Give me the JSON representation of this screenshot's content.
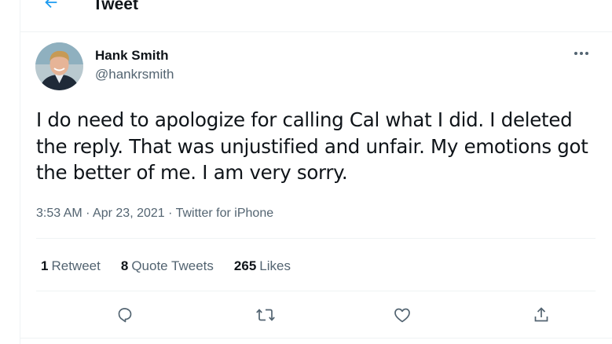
{
  "header": {
    "title": "Tweet",
    "back_icon": "arrow-left-icon",
    "accent_color": "#1d9bf0"
  },
  "tweet": {
    "author": {
      "name": "Hank Smith",
      "handle": "@hankrsmith"
    },
    "text": "I do need to apologize for calling Cal what I did. I deleted the reply. That was unjustified and unfair. My emotions got the better of me. I am very sorry.",
    "time": "3:53 AM",
    "separator": "·",
    "date": "Apr 23, 2021",
    "source": "Twitter for iPhone",
    "stats": {
      "retweets_count": "1",
      "retweets_label": "Retweet",
      "quotes_count": "8",
      "quotes_label": "Quote Tweets",
      "likes_count": "265",
      "likes_label": "Likes"
    },
    "actions": [
      "reply-icon",
      "retweet-icon",
      "like-icon",
      "share-icon"
    ],
    "more_icon": "more-dots-icon"
  }
}
